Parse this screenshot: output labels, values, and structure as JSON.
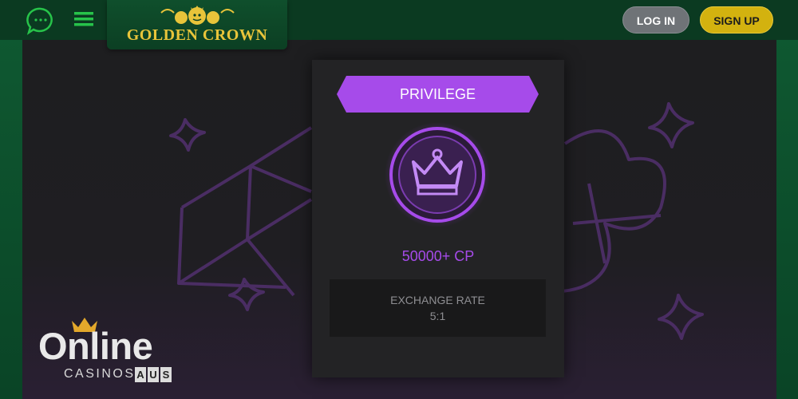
{
  "header": {
    "logo_text": "GOLDEN CROWN",
    "login_label": "LOG IN",
    "signup_label": "SIGN UP",
    "icons": [
      "chat-icon",
      "menu-icon"
    ]
  },
  "card": {
    "tier_label": "PRIVILEGE",
    "points_label": "50000+ CP",
    "exchange_title": "EXCHANGE RATE",
    "exchange_value": "5:1"
  },
  "watermark": {
    "online": "Online",
    "casinos": "CASINOS",
    "aus": [
      "A",
      "U",
      "S"
    ]
  },
  "colors": {
    "accent_purple": "#a64bea",
    "brand_gold": "#d3b20f",
    "header_green": "#0b3a21"
  }
}
